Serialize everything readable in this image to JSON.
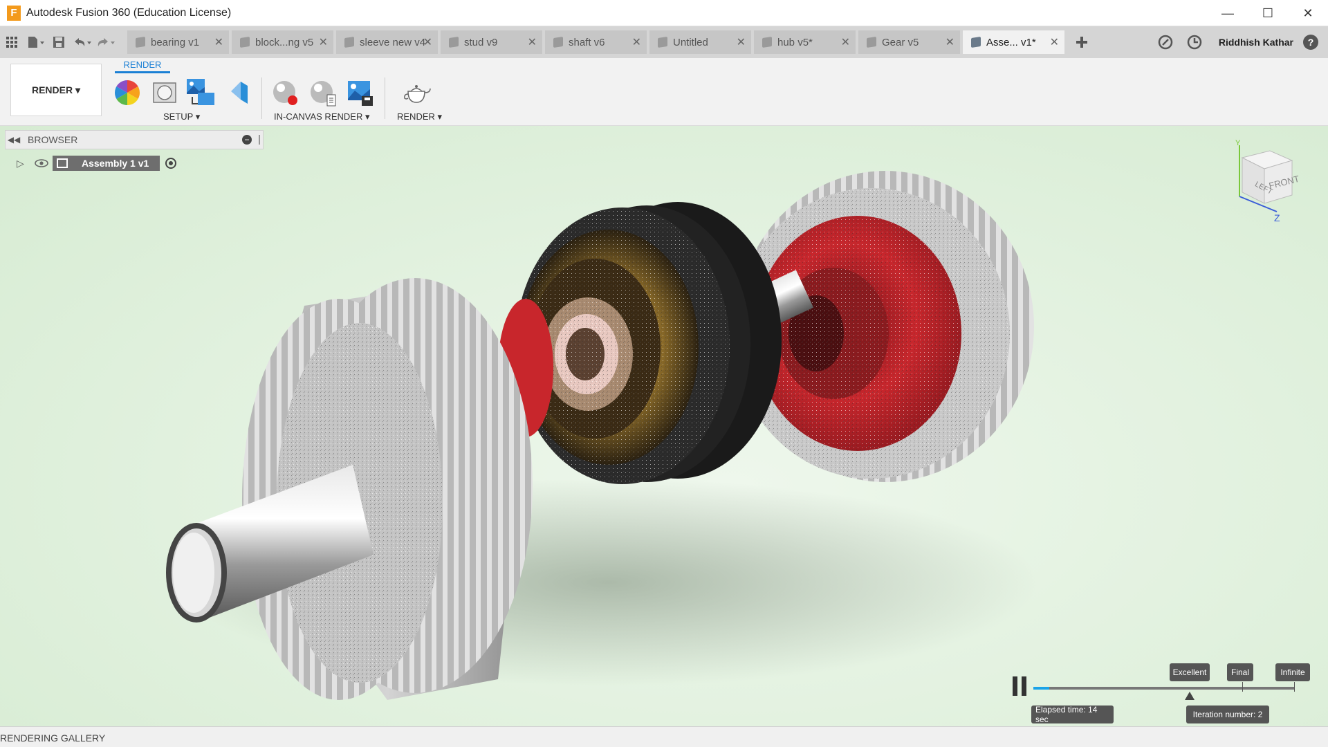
{
  "window": {
    "title": "Autodesk Fusion 360 (Education License)",
    "logo_letter": "F",
    "minimize": "—",
    "maximize": "☐",
    "close": "✕"
  },
  "tabs": [
    {
      "label": "bearing v1"
    },
    {
      "label": "block...ng v5"
    },
    {
      "label": "sleeve new v4"
    },
    {
      "label": "stud v9"
    },
    {
      "label": "shaft v6"
    },
    {
      "label": "Untitled"
    },
    {
      "label": "hub v5*"
    },
    {
      "label": "Gear v5"
    },
    {
      "label": "Asse... v1*"
    }
  ],
  "active_tab_index": 8,
  "user": {
    "name": "Riddhish Kathar"
  },
  "ribbon": {
    "tab": "RENDER",
    "workspace": "RENDER ▾",
    "groups": {
      "setup": "SETUP ▾",
      "in_canvas": "IN-CANVAS RENDER ▾",
      "render": "RENDER ▾"
    }
  },
  "browser": {
    "title": "BROWSER",
    "root": "Assembly 1 v1"
  },
  "viewcube": {
    "left": "LEFT",
    "front": "FRONT",
    "z": "Z",
    "y": "Y"
  },
  "render_progress": {
    "elapsed": "Elapsed time: 14 sec",
    "iteration": "Iteration number: 2",
    "quality_labels": [
      "Excellent",
      "Final",
      "Infinite"
    ],
    "progress_fraction": 0.06,
    "marker_fraction": 0.48
  },
  "bottom": {
    "gallery": "RENDERING GALLERY"
  },
  "colors": {
    "accent": "#1a7fd4",
    "progress": "#1aa3e8",
    "viewport_bg": "#e1f1de",
    "gear_red": "#c8262c"
  }
}
